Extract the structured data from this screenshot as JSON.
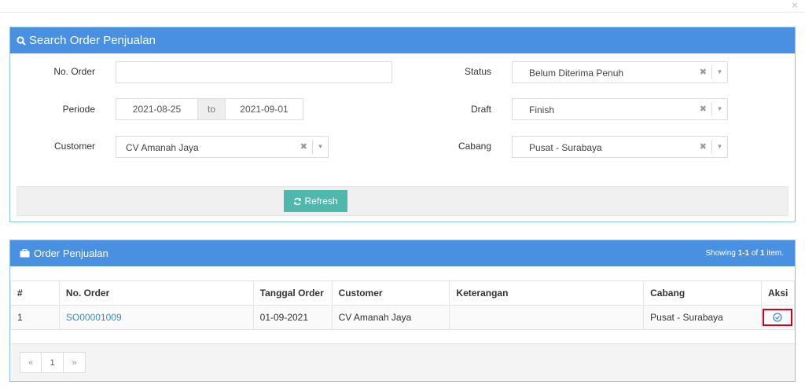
{
  "search": {
    "title": "Search Order Penjualan",
    "no_order_label": "No. Order",
    "no_order_value": "",
    "periode_label": "Periode",
    "periode_from": "2021-08-25",
    "periode_to_word": "to",
    "periode_to": "2021-09-01",
    "customer_label": "Customer",
    "customer_value": "CV Amanah Jaya",
    "status_label": "Status",
    "status_value": "Belum Diterima Penuh",
    "draft_label": "Draft",
    "draft_value": "Finish",
    "cabang_label": "Cabang",
    "cabang_value": "Pusat - Surabaya",
    "refresh_label": "Refresh"
  },
  "orders": {
    "title": "Order Penjualan",
    "showing_prefix": "Showing ",
    "showing_range": "1-1",
    "showing_of": " of ",
    "showing_total": "1",
    "showing_suffix": " item.",
    "columns": [
      "#",
      "No. Order",
      "Tanggal Order",
      "Customer",
      "Keterangan",
      "Cabang",
      "Aksi"
    ],
    "rows": [
      {
        "num": "1",
        "no_order": "SO00001009",
        "tanggal": "01-09-2021",
        "customer": "CV Amanah Jaya",
        "keterangan": "",
        "cabang": "Pusat - Surabaya"
      }
    ],
    "pager": {
      "prev": "«",
      "page": "1",
      "next": "»"
    }
  },
  "icons": {
    "search": "search-icon",
    "refresh": "refresh-icon",
    "briefcase": "briefcase-icon",
    "action": "check-circle-icon",
    "close": "close-icon"
  },
  "colors": {
    "header_blue": "#4a90e2",
    "refresh_teal": "#4fb8ac",
    "highlight_red": "#d0021b",
    "link_blue": "#3c8dbc"
  }
}
